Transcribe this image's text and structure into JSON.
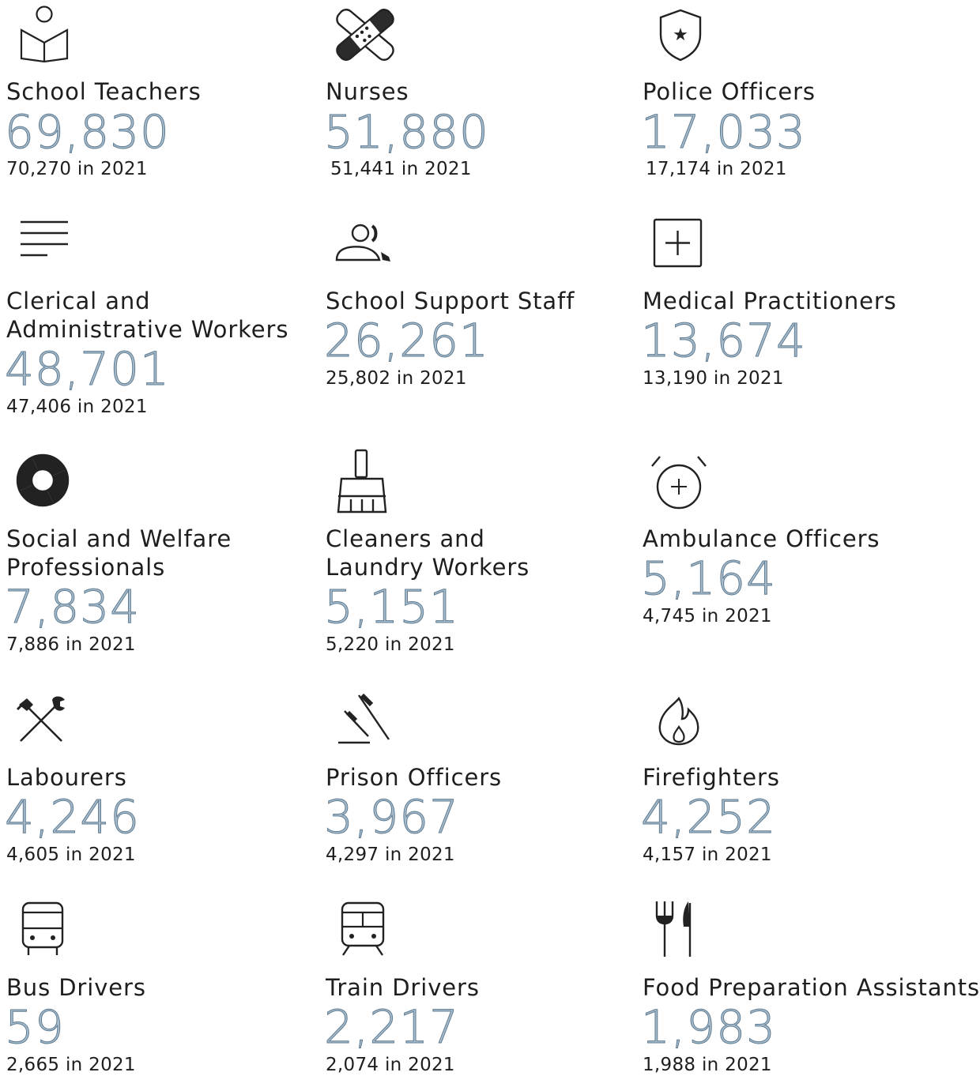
{
  "items": [
    {
      "label": "School Teachers",
      "value": "69,830",
      "previous": "70,270 in 2021",
      "icon": "reading-person-icon"
    },
    {
      "label": "Nurses",
      "value": "51,880",
      "previous": "51,441 in 2021",
      "icon": "bandage-icon"
    },
    {
      "label": "Police Officers",
      "value": "17,033",
      "previous": "17,174 in 2021",
      "icon": "police-badge-icon"
    },
    {
      "label": "Clerical and\nAdministrative Workers",
      "value": "48,701",
      "previous": "47,406 in 2021",
      "icon": "text-lines-icon"
    },
    {
      "label": "School Support Staff",
      "value": "26,261",
      "previous": "25,802 in 2021",
      "icon": "support-person-icon"
    },
    {
      "label": "Medical Practitioners",
      "value": "13,674",
      "previous": "13,190 in 2021",
      "icon": "medical-cross-icon"
    },
    {
      "label": "Social and Welfare\nProfessionals",
      "value": "7,834",
      "previous": "7,886 in 2021",
      "icon": "lifebuoy-icon"
    },
    {
      "label": "Cleaners and\nLaundry Workers",
      "value": "5,151",
      "previous": "5,220 in 2021",
      "icon": "brush-icon"
    },
    {
      "label": "Ambulance Officers",
      "value": "5,164",
      "previous": "4,745 in 2021",
      "icon": "alarm-plus-icon"
    },
    {
      "label": "Labourers",
      "value": "4,246",
      "previous": "4,605 in 2021",
      "icon": "crossed-tools-icon"
    },
    {
      "label": "Prison Officers",
      "value": "3,967",
      "previous": "4,297 in 2021",
      "icon": "baton-icon"
    },
    {
      "label": "Firefighters",
      "value": "4,252",
      "previous": "4,157 in 2021",
      "icon": "flame-icon"
    },
    {
      "label": "Bus Drivers",
      "value": "59",
      "previous": "2,665 in 2021",
      "icon": "bus-icon"
    },
    {
      "label": "Train Drivers",
      "value": "2,217",
      "previous": "2,074 in 2021",
      "icon": "train-icon"
    },
    {
      "label": "Food Preparation Assistants",
      "value": "1,983",
      "previous": "1,988 in 2021",
      "icon": "fork-knife-icon"
    }
  ]
}
